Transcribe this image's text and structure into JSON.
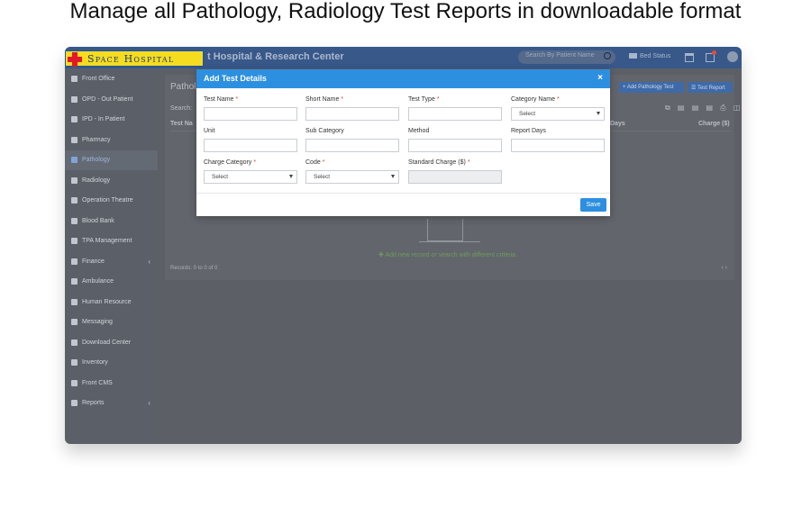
{
  "headline": "Manage all Pathology, Radiology Test Reports in downloadable format",
  "topbar": {
    "logo_text": "Space Hospital",
    "hospital_name": "t Hospital & Research Center",
    "search_placeholder": "Search By Patient Name",
    "bed_status": "Bed Status"
  },
  "sidebar": {
    "items": [
      {
        "label": "Front Office",
        "has_arrow": false
      },
      {
        "label": "OPD - Out Patient",
        "has_arrow": false
      },
      {
        "label": "IPD - In Patient",
        "has_arrow": false
      },
      {
        "label": "Pharmacy",
        "has_arrow": false
      },
      {
        "label": "Pathology",
        "has_arrow": false,
        "active": true
      },
      {
        "label": "Radiology",
        "has_arrow": false
      },
      {
        "label": "Operation Theatre",
        "has_arrow": false
      },
      {
        "label": "Blood Bank",
        "has_arrow": false
      },
      {
        "label": "TPA Management",
        "has_arrow": false
      },
      {
        "label": "Finance",
        "has_arrow": true
      },
      {
        "label": "Ambulance",
        "has_arrow": false
      },
      {
        "label": "Human Resource",
        "has_arrow": false
      },
      {
        "label": "Messaging",
        "has_arrow": false
      },
      {
        "label": "Download Center",
        "has_arrow": false
      },
      {
        "label": "Inventory",
        "has_arrow": false
      },
      {
        "label": "Front CMS",
        "has_arrow": false
      },
      {
        "label": "Reports",
        "has_arrow": true
      }
    ],
    "arrow_glyph": "‹"
  },
  "main": {
    "title": "Pathol",
    "search_label": "Search:",
    "add_button": "+ Add Pathology Test",
    "test_report_button": "☰ Test Report",
    "tool_icons": "⧉ ▤ ▤ ▤ ⎙ ◫",
    "columns": [
      "Test Na",
      "rt Days",
      "Charge ($)"
    ],
    "empty_message": "✚ Add new record or search with different criteria.",
    "records": "Records: 0 to 0 of 0",
    "pager": "‹ ›"
  },
  "modal": {
    "title": "Add Test Details",
    "close": "×",
    "fields": {
      "test_name": {
        "label": "Test Name",
        "required": "*"
      },
      "short_name": {
        "label": "Short Name",
        "required": "*"
      },
      "test_type": {
        "label": "Test Type",
        "required": "*"
      },
      "category_name": {
        "label": "Category Name",
        "required": "*",
        "value": "Select"
      },
      "unit": {
        "label": "Unit"
      },
      "sub_category": {
        "label": "Sub Category"
      },
      "method": {
        "label": "Method"
      },
      "report_days": {
        "label": "Report Days"
      },
      "charge_category": {
        "label": "Charge Category",
        "required": "*",
        "value": "Select"
      },
      "code": {
        "label": "Code",
        "required": "*",
        "value": "Select"
      },
      "standard_charge": {
        "label": "Standard Charge ($)",
        "required": "*"
      }
    },
    "save": "Save"
  },
  "colors": {
    "modal_header": "#2d8fe0",
    "topbar": "#38588a",
    "logo_bg": "#f6dc1f",
    "logo_cross": "#e0192a",
    "required_star": "#e04040"
  }
}
